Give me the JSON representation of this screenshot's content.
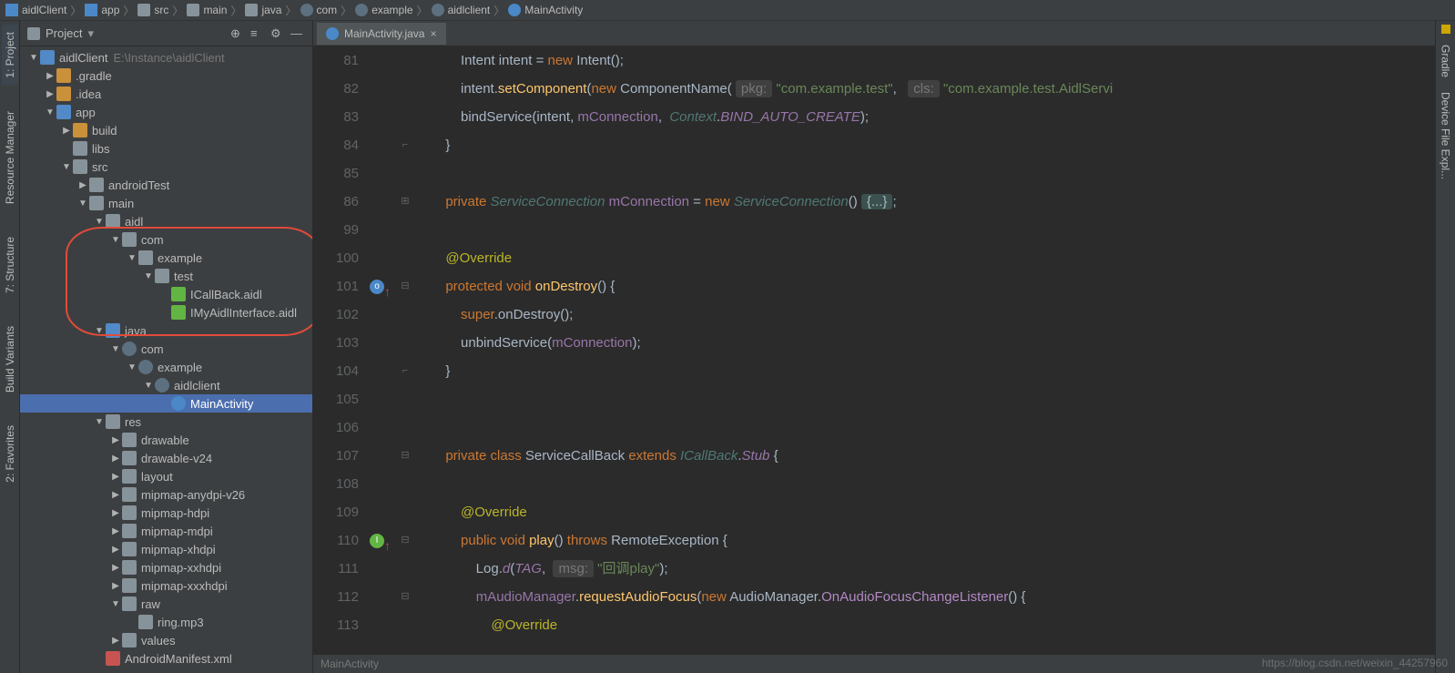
{
  "breadcrumb": [
    {
      "label": "aidlClient",
      "icon": "mod"
    },
    {
      "label": "app",
      "icon": "mod"
    },
    {
      "label": "src",
      "icon": "folder"
    },
    {
      "label": "main",
      "icon": "folder"
    },
    {
      "label": "java",
      "icon": "folder"
    },
    {
      "label": "com",
      "icon": "pkg"
    },
    {
      "label": "example",
      "icon": "pkg"
    },
    {
      "label": "aidlclient",
      "icon": "pkg"
    },
    {
      "label": "MainActivity",
      "icon": "cls"
    }
  ],
  "projectPanel": {
    "title": "Project",
    "rootPath": "E:\\Instance\\aidlClient"
  },
  "tree": [
    {
      "d": 0,
      "a": "down",
      "ic": "mod",
      "l": "aidlClient",
      "extra": "E:\\Instance\\aidlClient"
    },
    {
      "d": 1,
      "a": "right",
      "ic": "folder-o",
      "l": ".gradle",
      "c": "#c9913a"
    },
    {
      "d": 1,
      "a": "right",
      "ic": "folder-o",
      "l": ".idea",
      "c": "#c9913a"
    },
    {
      "d": 1,
      "a": "down",
      "ic": "mod",
      "l": "app"
    },
    {
      "d": 2,
      "a": "right",
      "ic": "folder-o",
      "l": "build",
      "c": "#c9913a"
    },
    {
      "d": 2,
      "a": "none",
      "ic": "folder",
      "l": "libs"
    },
    {
      "d": 2,
      "a": "down",
      "ic": "folder",
      "l": "src"
    },
    {
      "d": 3,
      "a": "right",
      "ic": "folder",
      "l": "androidTest"
    },
    {
      "d": 3,
      "a": "down",
      "ic": "folder",
      "l": "main"
    },
    {
      "d": 4,
      "a": "down",
      "ic": "folder",
      "l": "aidl"
    },
    {
      "d": 5,
      "a": "down",
      "ic": "folder",
      "l": "com"
    },
    {
      "d": 6,
      "a": "down",
      "ic": "folder",
      "l": "example"
    },
    {
      "d": 7,
      "a": "down",
      "ic": "folder",
      "l": "test"
    },
    {
      "d": 8,
      "a": "none",
      "ic": "aidl",
      "l": "ICallBack.aidl"
    },
    {
      "d": 8,
      "a": "none",
      "ic": "aidl",
      "l": "IMyAidlInterface.aidl"
    },
    {
      "d": 4,
      "a": "down",
      "ic": "java",
      "l": "java"
    },
    {
      "d": 5,
      "a": "down",
      "ic": "pkg",
      "l": "com"
    },
    {
      "d": 6,
      "a": "down",
      "ic": "pkg",
      "l": "example"
    },
    {
      "d": 7,
      "a": "down",
      "ic": "pkg",
      "l": "aidlclient"
    },
    {
      "d": 8,
      "a": "none",
      "ic": "class",
      "l": "MainActivity",
      "sel": true
    },
    {
      "d": 4,
      "a": "down",
      "ic": "folder",
      "l": "res"
    },
    {
      "d": 5,
      "a": "right",
      "ic": "folder",
      "l": "drawable"
    },
    {
      "d": 5,
      "a": "right",
      "ic": "folder",
      "l": "drawable-v24"
    },
    {
      "d": 5,
      "a": "right",
      "ic": "folder",
      "l": "layout"
    },
    {
      "d": 5,
      "a": "right",
      "ic": "folder",
      "l": "mipmap-anydpi-v26"
    },
    {
      "d": 5,
      "a": "right",
      "ic": "folder",
      "l": "mipmap-hdpi"
    },
    {
      "d": 5,
      "a": "right",
      "ic": "folder",
      "l": "mipmap-mdpi"
    },
    {
      "d": 5,
      "a": "right",
      "ic": "folder",
      "l": "mipmap-xhdpi"
    },
    {
      "d": 5,
      "a": "right",
      "ic": "folder",
      "l": "mipmap-xxhdpi"
    },
    {
      "d": 5,
      "a": "right",
      "ic": "folder",
      "l": "mipmap-xxxhdpi"
    },
    {
      "d": 5,
      "a": "down",
      "ic": "folder",
      "l": "raw"
    },
    {
      "d": 6,
      "a": "none",
      "ic": "snd",
      "l": "ring.mp3"
    },
    {
      "d": 5,
      "a": "right",
      "ic": "folder",
      "l": "values"
    },
    {
      "d": 4,
      "a": "none",
      "ic": "xml",
      "l": "AndroidManifest.xml"
    }
  ],
  "leftTabs": [
    "1: Project",
    "Resource Manager",
    "7: Structure",
    "Build Variants",
    "2: Favorites"
  ],
  "rightTabs": [
    "Gradle",
    "Device File Expl..."
  ],
  "editor": {
    "tabLabel": "MainActivity.java",
    "crumb": "MainActivity",
    "lines": [
      {
        "n": 81,
        "html": "            Intent intent = <span class='kw'>new</span> Intent();"
      },
      {
        "n": 82,
        "html": "            intent.<span class='mth'>setComponent</span>(<span class='kw'>new</span> ComponentName( <span class='param-hint'>pkg:</span> <span class='str'>\"com.example.test\"</span>,   <span class='param-hint'>cls:</span> <span class='str'>\"com.example.test.AidlServi</span>"
      },
      {
        "n": 83,
        "html": "            bindService(intent, <span class='field'>mConnection</span>,  <span class='it2'>Context</span>.<span class='it'>BIND_AUTO_CREATE</span>);"
      },
      {
        "n": 84,
        "html": "        }",
        "fold": "up"
      },
      {
        "n": 85,
        "html": ""
      },
      {
        "n": 86,
        "html": "        <span class='kw'>private</span> <span class='it2'>ServiceConnection</span> <span class='field'>mConnection</span> = <span class='kw'>new</span> <span class='it2'>ServiceConnection</span>() <span class='fold-pill'>{...}</span>;",
        "fold": "plus"
      },
      {
        "n": 99,
        "html": ""
      },
      {
        "n": 100,
        "html": "        <span class='ann'>@Override</span>"
      },
      {
        "n": 101,
        "html": "        <span class='kw'>protected</span> <span class='kw'>void</span> <span class='mth'>onDestroy</span>() {",
        "fold": "minus",
        "mk": "blue-up"
      },
      {
        "n": 102,
        "html": "            <span class='kw'>super</span>.onDestroy();"
      },
      {
        "n": 103,
        "html": "            unbindService(<span class='field'>mConnection</span>);"
      },
      {
        "n": 104,
        "html": "        }",
        "fold": "up"
      },
      {
        "n": 105,
        "html": ""
      },
      {
        "n": 106,
        "html": ""
      },
      {
        "n": 107,
        "html": "        <span class='kw'>private</span> <span class='kw'>class</span> <span class='type'>ServiceCallBack</span> <span class='kw'>extends</span> <span class='it2'>ICallBack</span>.<span class='it'>Stub</span> {",
        "fold": "minus"
      },
      {
        "n": 108,
        "html": ""
      },
      {
        "n": 109,
        "html": "            <span class='ann'>@Override</span>"
      },
      {
        "n": 110,
        "html": "            <span class='kw'>public</span> <span class='kw'>void</span> <span class='mth'>play</span>() <span class='kw'>throws</span> RemoteException {",
        "fold": "minus",
        "mk": "green-up"
      },
      {
        "n": 111,
        "html": "                Log.<span class='it'>d</span>(<span class='it'>TAG</span>,  <span class='param-hint'>msg:</span> <span class='str'>\"回调play\"</span>);"
      },
      {
        "n": 112,
        "html": "                <span class='field'>mAudioManager</span>.<span class='mth'>requestAudioFocus</span>(<span class='kw'>new</span> AudioManager.<span class='mth2'>OnAudioFocusChangeListener</span>() {",
        "fold": "minus"
      },
      {
        "n": 113,
        "html": "                    <span class='ann'>@Override</span>"
      }
    ]
  },
  "watermark": "https://blog.csdn.net/weixin_44257960"
}
